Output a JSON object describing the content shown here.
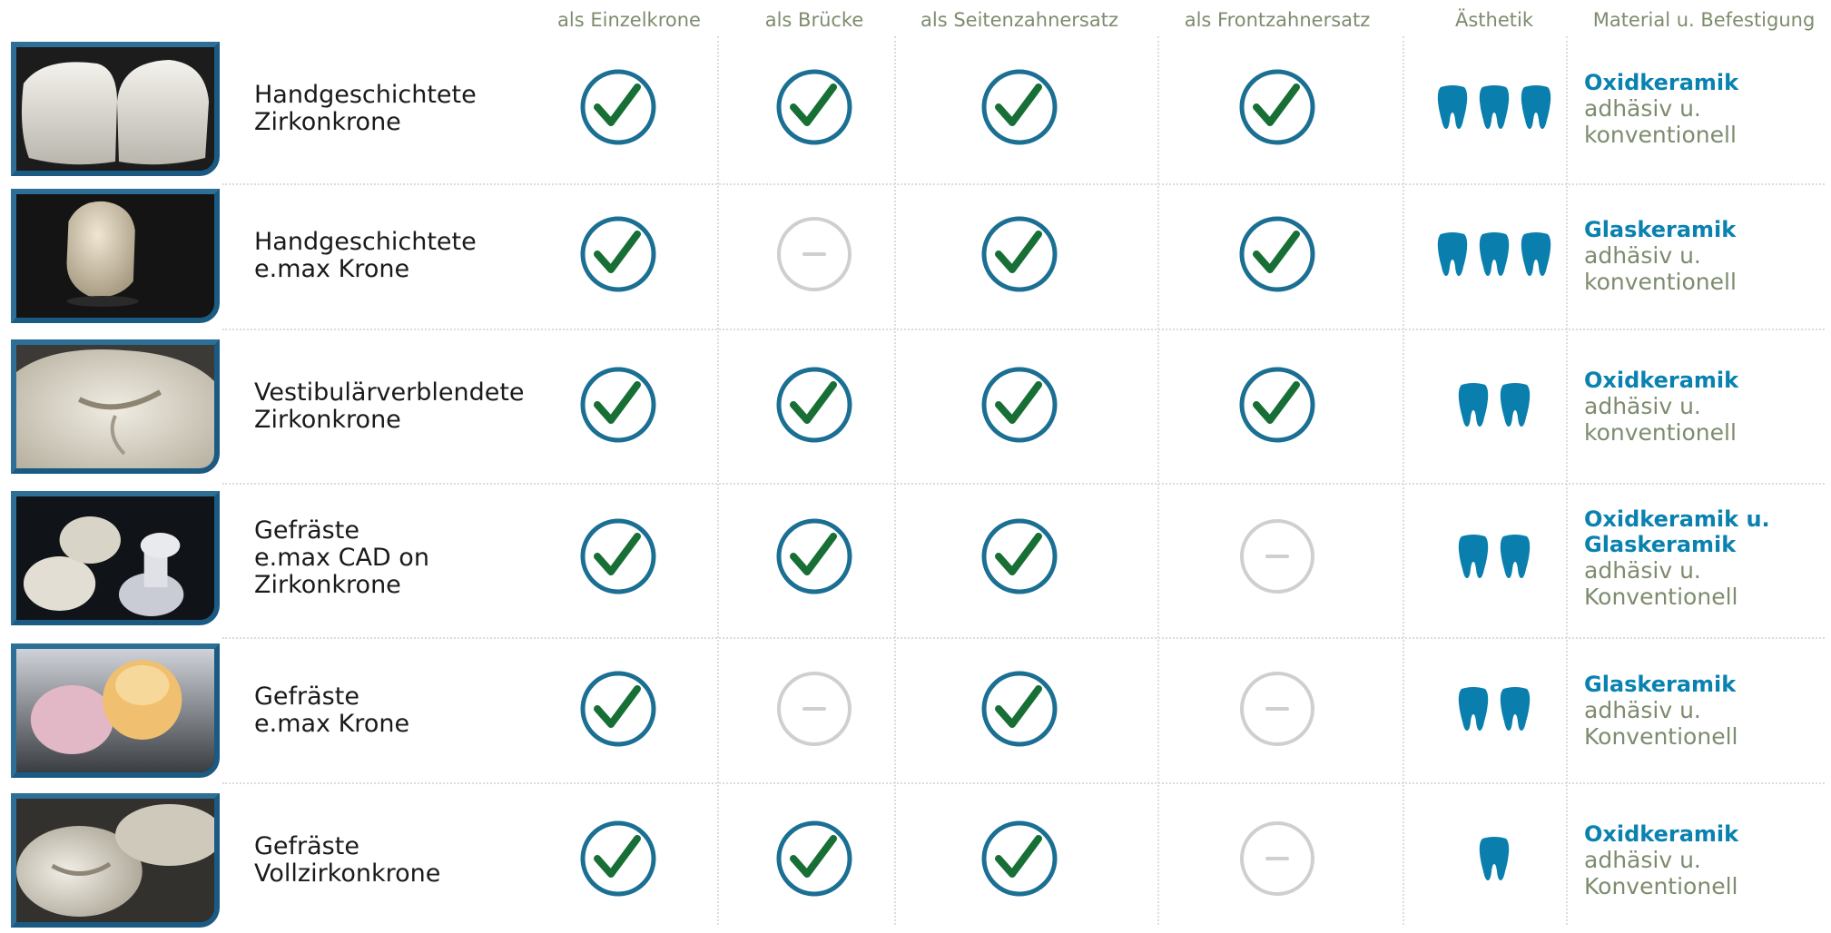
{
  "headers": {
    "einzelkrone": "als Einzelkrone",
    "bruecke": "als Brücke",
    "seitenzahnersatz": "als Seitenzahnersatz",
    "frontzahnersatz": "als Frontzahnersatz",
    "aesthetik": "Ästhetik",
    "material": "Material u. Befestigung"
  },
  "colors": {
    "header_text": "#7d8c6e",
    "check_ring": "#1a6f93",
    "check_mark": "#176f35",
    "dash_ring": "#cfcfcf",
    "tooth": "#0a7fae",
    "material_name": "#0a82b0",
    "material_fixation": "#7d8c6e",
    "photo_frame": "#2d6f96"
  },
  "icons": {
    "yes": "check-circle-icon",
    "no": "dash-circle-icon",
    "aesthetics": "tooth-icon"
  },
  "rows": [
    {
      "name_line1": "Handgeschichtete",
      "name_line2": "Zirkonkrone",
      "name_line3": "",
      "einzelkrone": true,
      "bruecke": true,
      "seitenzahnersatz": true,
      "frontzahnersatz": true,
      "aesthetik": 3,
      "material_line1": "Oxidkeramik",
      "material_line2": "",
      "fixation_line1": "adhäsiv u.",
      "fixation_line2": "konventionell"
    },
    {
      "name_line1": "Handgeschichtete",
      "name_line2": "e.max Krone",
      "name_line3": "",
      "einzelkrone": true,
      "bruecke": false,
      "seitenzahnersatz": true,
      "frontzahnersatz": true,
      "aesthetik": 3,
      "material_line1": "Glaskeramik",
      "material_line2": "",
      "fixation_line1": "adhäsiv u.",
      "fixation_line2": "konventionell"
    },
    {
      "name_line1": "Vestibulärverblendete",
      "name_line2": "Zirkonkrone",
      "name_line3": "",
      "einzelkrone": true,
      "bruecke": true,
      "seitenzahnersatz": true,
      "frontzahnersatz": true,
      "aesthetik": 2,
      "material_line1": "Oxidkeramik",
      "material_line2": "",
      "fixation_line1": "adhäsiv u.",
      "fixation_line2": "konventionell"
    },
    {
      "name_line1": "Gefräste",
      "name_line2": "e.max CAD on",
      "name_line3": "Zirkonkrone",
      "einzelkrone": true,
      "bruecke": true,
      "seitenzahnersatz": true,
      "frontzahnersatz": false,
      "aesthetik": 2,
      "material_line1": "Oxidkeramik u.",
      "material_line2": "Glaskeramik",
      "fixation_line1": "adhäsiv u.",
      "fixation_line2": "Konventionell"
    },
    {
      "name_line1": "Gefräste",
      "name_line2": "e.max Krone",
      "name_line3": "",
      "einzelkrone": true,
      "bruecke": false,
      "seitenzahnersatz": true,
      "frontzahnersatz": false,
      "aesthetik": 2,
      "material_line1": "Glaskeramik",
      "material_line2": "",
      "fixation_line1": "adhäsiv u.",
      "fixation_line2": "Konventionell"
    },
    {
      "name_line1": "Gefräste",
      "name_line2": "Vollzirkonkrone",
      "name_line3": "",
      "einzelkrone": true,
      "bruecke": true,
      "seitenzahnersatz": true,
      "frontzahnersatz": false,
      "aesthetik": 1,
      "material_line1": "Oxidkeramik",
      "material_line2": "",
      "fixation_line1": "adhäsiv u.",
      "fixation_line2": "Konventionell"
    }
  ]
}
